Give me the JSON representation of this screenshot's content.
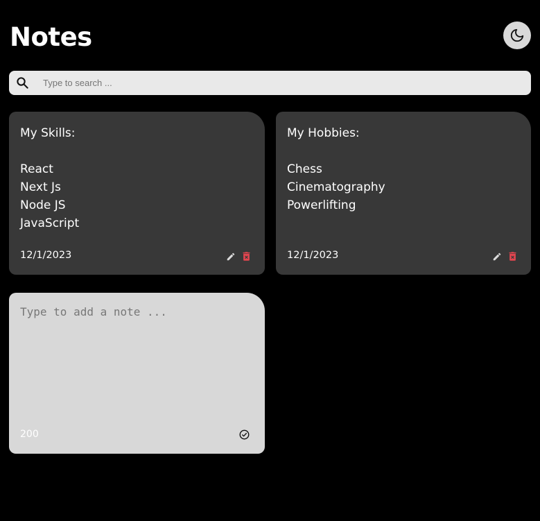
{
  "header": {
    "title": "Notes",
    "theme_toggle_icon": "moon-icon"
  },
  "search": {
    "placeholder": "Type to search ...",
    "value": "",
    "icon": "search-icon"
  },
  "notes": [
    {
      "text": "My Skills:\n\nReact\nNext Js\nNode JS\nJavaScript",
      "date": "12/1/2023",
      "edit_icon": "pencil-icon",
      "delete_icon": "trash-icon"
    },
    {
      "text": "My Hobbies:\n\nChess\nCinematography\nPowerlifting",
      "date": "12/1/2023",
      "edit_icon": "pencil-icon",
      "delete_icon": "trash-icon"
    }
  ],
  "new_note": {
    "placeholder": "Type to add a note ...",
    "value": "",
    "remaining_chars": "200",
    "save_icon": "check-circle-icon"
  },
  "colors": {
    "background": "#000000",
    "note_card": "#383838",
    "new_note_card": "#d8d8d8",
    "delete_icon": "#e2454f",
    "search_bar": "#e9e9e9"
  }
}
